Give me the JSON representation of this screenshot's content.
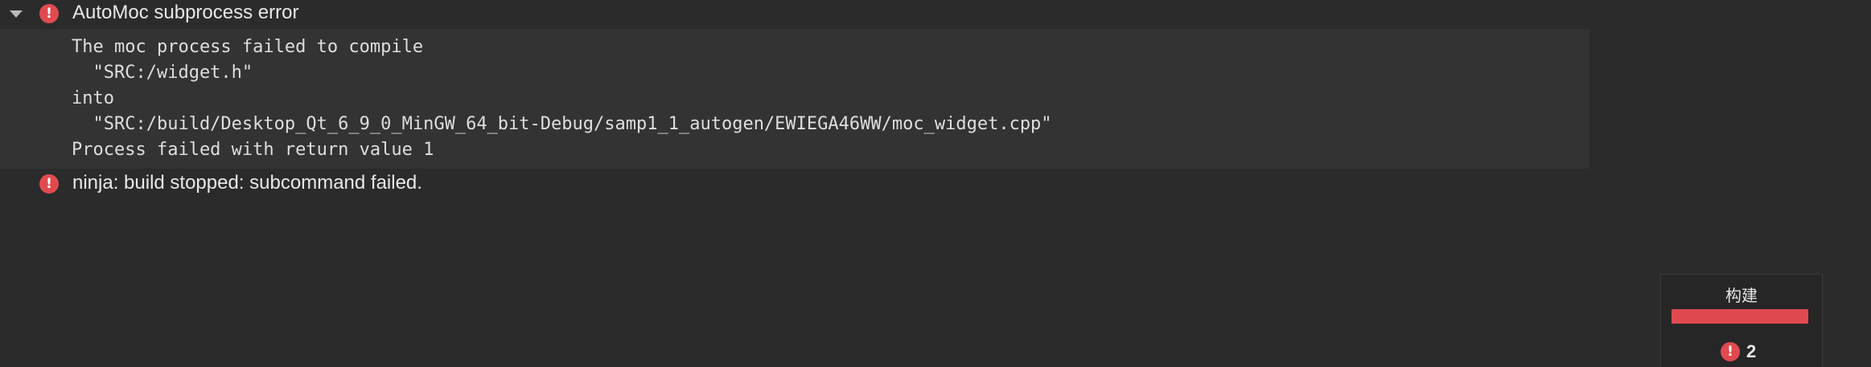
{
  "issues": [
    {
      "title": "AutoMoc subprocess error",
      "expanded": true,
      "icon": "error-icon",
      "details": [
        "The moc process failed to compile",
        "  \"SRC:/widget.h\"",
        "into",
        "  \"SRC:/build/Desktop_Qt_6_9_0_MinGW_64_bit-Debug/samp1_1_autogen/EWIEGA46WW/moc_widget.cpp\"",
        "Process failed with return value 1"
      ]
    },
    {
      "title": "ninja: build stopped: subcommand failed.",
      "expanded": false,
      "icon": "error-icon"
    }
  ],
  "build_status": {
    "label": "构建",
    "error_count": "2",
    "progress_state": "failed",
    "progress_fraction": 1.0
  },
  "icon_glyphs": {
    "error": "!"
  },
  "colors": {
    "error": "#e04a4f",
    "background": "#2b2b2b",
    "details_background": "#333333"
  }
}
